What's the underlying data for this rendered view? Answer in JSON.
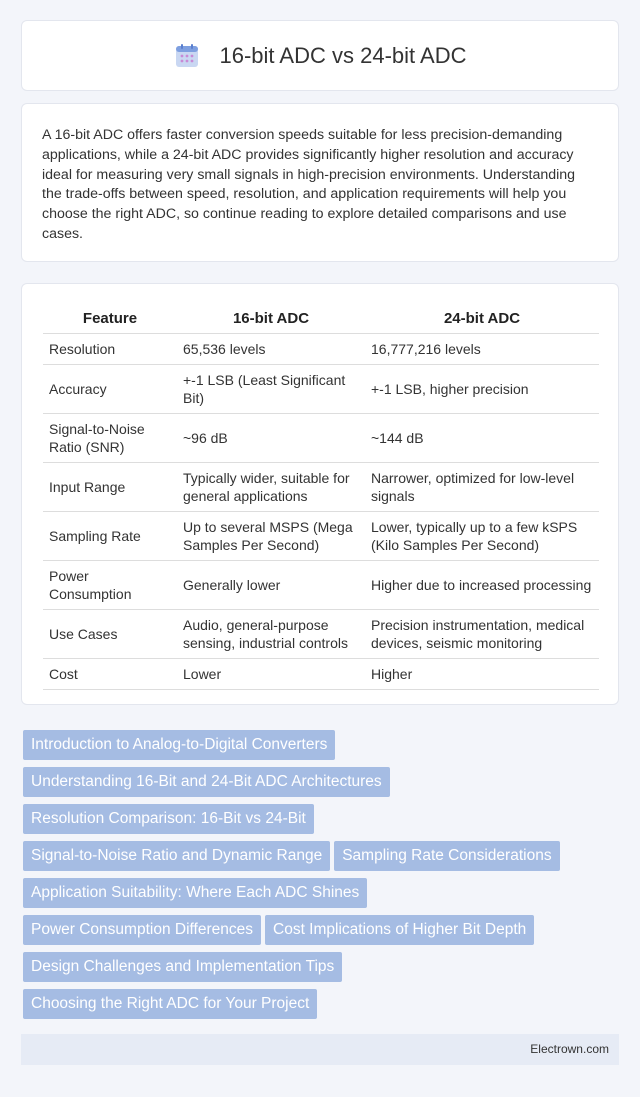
{
  "header": {
    "title": "16-bit ADC vs 24-bit ADC",
    "icon": "calendar-icon"
  },
  "intro": {
    "text": "A 16-bit ADC offers faster conversion speeds suitable for less precision-demanding applications, while a 24-bit ADC provides significantly higher resolution and accuracy ideal for measuring very small signals in high-precision environments. Understanding the trade-offs between speed, resolution, and application requirements will help you choose the right ADC, so continue reading to explore detailed comparisons and use cases."
  },
  "table": {
    "headers": [
      "Feature",
      "16-bit ADC",
      "24-bit ADC"
    ],
    "rows": [
      [
        "Resolution",
        "65,536 levels",
        "16,777,216 levels"
      ],
      [
        "Accuracy",
        "+-1 LSB (Least Significant Bit)",
        "+-1 LSB, higher precision"
      ],
      [
        "Signal-to-Noise Ratio (SNR)",
        "~96 dB",
        "~144 dB"
      ],
      [
        "Input Range",
        "Typically wider, suitable for general applications",
        "Narrower, optimized for low-level signals"
      ],
      [
        "Sampling Rate",
        "Up to several MSPS (Mega Samples Per Second)",
        "Lower, typically up to a few kSPS (Kilo Samples Per Second)"
      ],
      [
        "Power Consumption",
        "Generally lower",
        "Higher due to increased processing"
      ],
      [
        "Use Cases",
        "Audio, general-purpose sensing, industrial controls",
        "Precision instrumentation, medical devices, seismic monitoring"
      ],
      [
        "Cost",
        "Lower",
        "Higher"
      ]
    ]
  },
  "topics": [
    "Introduction to Analog-to-Digital Converters",
    "Understanding 16-Bit and 24-Bit ADC Architectures",
    "Resolution Comparison: 16-Bit vs 24-Bit",
    "Signal-to-Noise Ratio and Dynamic Range",
    "Sampling Rate Considerations",
    "Application Suitability: Where Each ADC Shines",
    "Power Consumption Differences",
    "Cost Implications of Higher Bit Depth",
    "Design Challenges and Implementation Tips",
    "Choosing the Right ADC for Your Project"
  ],
  "footer": {
    "text": "Electrown.com"
  },
  "colors": {
    "tag_bg": "#a5bce3",
    "footer_bg": "#e6ebf5",
    "page_bg": "#f3f5fa"
  }
}
